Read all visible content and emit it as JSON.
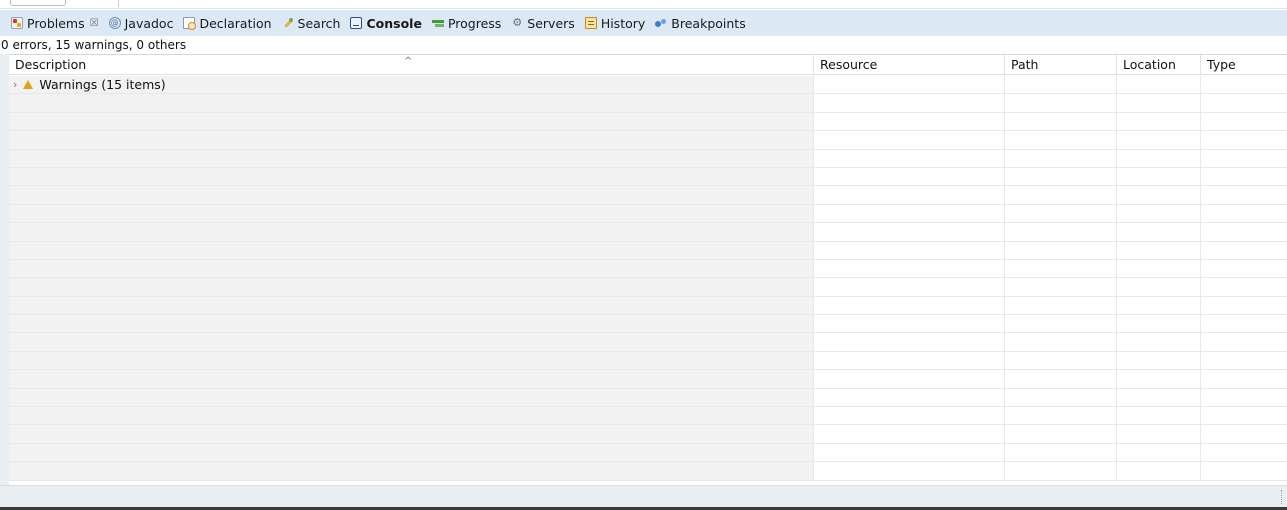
{
  "tabs": [
    {
      "label": "Problems",
      "icon": "problems-icon",
      "closable": true,
      "active": true
    },
    {
      "label": "Javadoc",
      "icon": "javadoc-icon"
    },
    {
      "label": "Declaration",
      "icon": "declaration-icon"
    },
    {
      "label": "Search",
      "icon": "search-icon"
    },
    {
      "label": "Console",
      "icon": "console-icon",
      "bold": true
    },
    {
      "label": "Progress",
      "icon": "progress-icon"
    },
    {
      "label": "Servers",
      "icon": "servers-icon"
    },
    {
      "label": "History",
      "icon": "history-icon"
    },
    {
      "label": "Breakpoints",
      "icon": "breakpoints-icon"
    }
  ],
  "tab_close_glyph": "☒",
  "summary": "0 errors, 15 warnings, 0 others",
  "table": {
    "columns": {
      "description": "Description",
      "resource": "Resource",
      "path": "Path",
      "location": "Location",
      "type": "Type"
    },
    "sort_column": "description",
    "sort_caret": "^",
    "warnings_group": {
      "label": "Warnings (15 items)",
      "expander": "›",
      "expanded": false
    },
    "empty_row_count": 21
  },
  "colors": {
    "tabbar_bg": "#dce9f5",
    "warning": "#e0a31a",
    "description_column_bg": "#f2f2f2"
  }
}
